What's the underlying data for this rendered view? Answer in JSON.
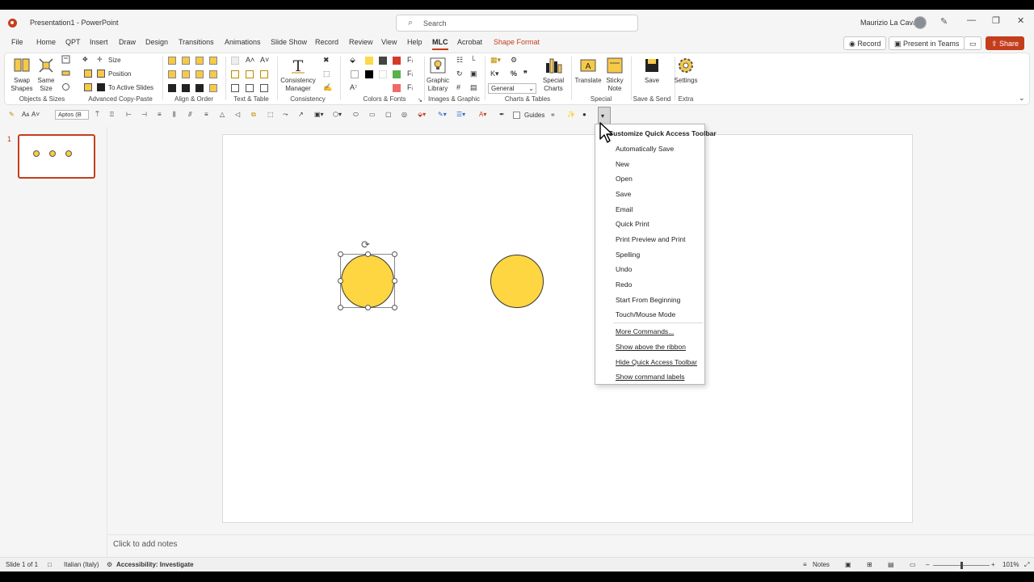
{
  "window": {
    "doc_title": "Presentation1 - PowerPoint",
    "search_placeholder": "Search",
    "user_name": "Maurizio La Cava"
  },
  "tabs": [
    "File",
    "Home",
    "QPT",
    "Insert",
    "Draw",
    "Design",
    "Transitions",
    "Animations",
    "Slide Show",
    "Record",
    "Review",
    "View",
    "Help",
    "MLC",
    "Acrobat",
    "Shape Format"
  ],
  "active_tab": "MLC",
  "contextual_tab": "Shape Format",
  "header_buttons": {
    "record": "Record",
    "present": "Present in Teams",
    "share": "Share"
  },
  "ribbon": {
    "objects_sizes": {
      "label": "Objects & Sizes",
      "swap": "Swap Shapes",
      "same": "Same Size",
      "size": "Size",
      "position": "Position",
      "to_active": "To Active Slides"
    },
    "groups": {
      "advanced_copy_paste": "Advanced Copy-Paste",
      "align_order": "Align & Order",
      "text_table": "Text & Table",
      "consistency": "Consistency",
      "colors_fonts": "Colors & Fonts",
      "images_graphic": "Images & Graphic",
      "charts_tables": "Charts & Tables",
      "special": "Special",
      "save_send": "Save & Send",
      "extra": "Extra"
    },
    "consistency_manager": "Consistency Manager",
    "graphic_library": "Graphic Library",
    "special_charts": "Special Charts",
    "number_format": "General",
    "translate": "Translate",
    "sticky_note": "Sticky Note",
    "save": "Save",
    "settings": "Settings"
  },
  "qat": {
    "font": "Aptos (B",
    "guides": "Guides"
  },
  "slide_panel": {
    "slide_number": "1"
  },
  "notes_placeholder": "Click to add notes",
  "status": {
    "slide": "Slide 1 of 1",
    "language": "Italian (Italy)",
    "accessibility": "Accessibility: Investigate",
    "notes": "Notes",
    "zoom": "101%"
  },
  "qat_menu": {
    "title": "Customize Quick Access Toolbar",
    "items": [
      "Automatically Save",
      "New",
      "Open",
      "Save",
      "Email",
      "Quick Print",
      "Print Preview and Print",
      "Spelling",
      "Undo",
      "Redo",
      "Start From Beginning",
      "Touch/Mouse Mode"
    ],
    "extra_items": [
      "More Commands...",
      "Show above the ribbon",
      "Hide Quick Access Toolbar",
      "Show command labels"
    ]
  },
  "colors": {
    "accent": "#c43e1c",
    "shape_fill": "#fed642"
  }
}
